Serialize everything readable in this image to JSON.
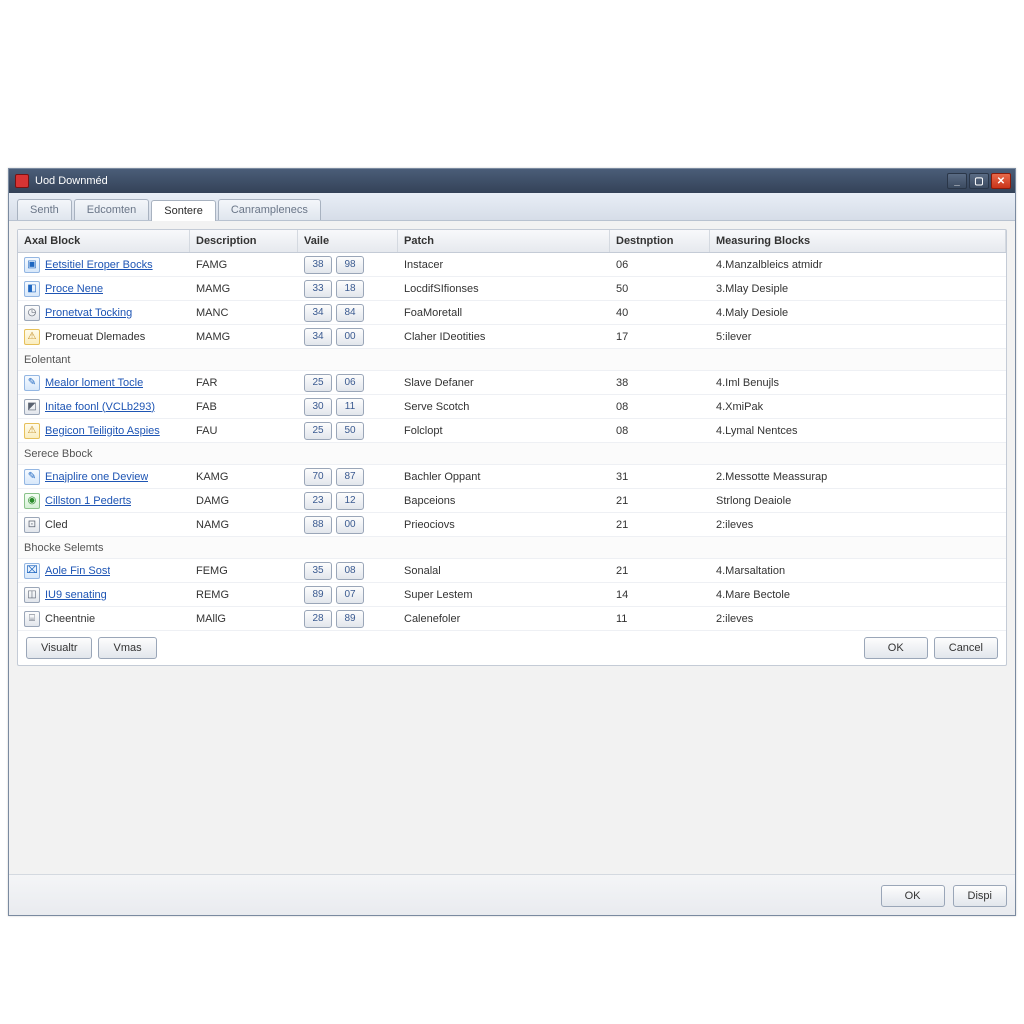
{
  "window": {
    "title": "Uod Downméd",
    "buttons": {
      "min": "_",
      "max": "▢",
      "close": "✕"
    }
  },
  "tabs": [
    {
      "label": "Senth"
    },
    {
      "label": "Edcomten"
    },
    {
      "label": "Sontere",
      "active": true
    },
    {
      "label": "Canramplenecs"
    }
  ],
  "columns": {
    "block": "Axal Block",
    "descr": "Description",
    "value": "Vaile",
    "patch": "Patch",
    "destn": "Destnption",
    "meas": "Measuring Blocks"
  },
  "groups": [
    {
      "label": "",
      "rows": [
        {
          "icon": "ic-blue",
          "glyph": "▣",
          "name": "Eetsitiel Eroper Bocks",
          "link": true,
          "descr": "FAMG",
          "v1": "38",
          "v2": "98",
          "patch": "Instacer",
          "destn": "06",
          "meas": "4.Manzalbleics atmidr"
        },
        {
          "icon": "ic-blue",
          "glyph": "◧",
          "name": "Proce Nene",
          "link": true,
          "descr": "MAMG",
          "v1": "33",
          "v2": "18",
          "patch": "LocdifSIfionses",
          "destn": "50",
          "meas": "3.Mlay Desiple"
        },
        {
          "icon": "ic-gray",
          "glyph": "◷",
          "name": "Pronetvat Tocking",
          "link": true,
          "descr": "MANC",
          "v1": "34",
          "v2": "84",
          "patch": "FoaMoretall",
          "destn": "40",
          "meas": "4.Maly Desiole"
        },
        {
          "icon": "ic-warn",
          "glyph": "⚠",
          "name": "Promeuat Dlemades",
          "link": false,
          "descr": "MAMG",
          "v1": "34",
          "v2": "00",
          "patch": "Claher IDeotities",
          "destn": "17",
          "meas": "5:ilever"
        }
      ]
    },
    {
      "label": "Eolentant",
      "rows": [
        {
          "icon": "ic-blue",
          "glyph": "✎",
          "name": "Mealor loment Tocle",
          "link": true,
          "descr": "FAR",
          "v1": "25",
          "v2": "06",
          "patch": "Slave Defaner",
          "destn": "38",
          "meas": "4.Iml Benujls"
        },
        {
          "icon": "ic-gray",
          "glyph": "◩",
          "name": "Initae foonl (VCLb293)",
          "link": true,
          "descr": "FAB",
          "v1": "30",
          "v2": "11",
          "patch": "Serve Scotch",
          "destn": "08",
          "meas": "4.XmiPak"
        },
        {
          "icon": "ic-warn",
          "glyph": "⚠",
          "name": "Begicon Teiligito Aspies",
          "link": true,
          "descr": "FAU",
          "v1": "25",
          "v2": "50",
          "patch": "Folclopt",
          "destn": "08",
          "meas": "4.Lymal Nentces"
        }
      ]
    },
    {
      "label": "Serece Bbock",
      "rows": [
        {
          "icon": "ic-blue",
          "glyph": "✎",
          "name": "Enajplire one Deview",
          "link": true,
          "descr": "KAMG",
          "v1": "70",
          "v2": "87",
          "patch": "Bachler Oppant",
          "destn": "31",
          "meas": "2.Messotte Meassurap"
        },
        {
          "icon": "ic-green",
          "glyph": "◉",
          "name": "Cillston 1 Pederts",
          "link": true,
          "descr": "DAMG",
          "v1": "23",
          "v2": "12",
          "patch": "Bapceions",
          "destn": "21",
          "meas": "Strlong Deaiole"
        },
        {
          "icon": "ic-gray",
          "glyph": "⊡",
          "name": "Cled",
          "link": false,
          "descr": "NAMG",
          "v1": "88",
          "v2": "00",
          "patch": "Prieociovs",
          "destn": "21",
          "meas": "2:ileves"
        }
      ]
    },
    {
      "label": "Bhocke Selemts",
      "rows": [
        {
          "icon": "ic-blue",
          "glyph": "⌧",
          "name": "Aole Fin Sost",
          "link": true,
          "descr": "FEMG",
          "v1": "35",
          "v2": "08",
          "patch": "Sonalal",
          "destn": "21",
          "meas": "4.Marsaltation"
        },
        {
          "icon": "ic-gray",
          "glyph": "◫",
          "name": "IU9 senating",
          "link": true,
          "descr": "REMG",
          "v1": "89",
          "v2": "07",
          "patch": "Super Lestem",
          "destn": "14",
          "meas": "4.Mare Bectole"
        },
        {
          "icon": "ic-gray",
          "glyph": "⌸",
          "name": "Cheentnie",
          "link": false,
          "descr": "MAllG",
          "v1": "28",
          "v2": "89",
          "patch": "Calenefoler",
          "destn": "11",
          "meas": "2:ileves"
        }
      ]
    }
  ],
  "panel_footer": {
    "visualtr": "Visualtr",
    "vmas": "Vmas",
    "ok": "OK",
    "cancel": "Cancel"
  },
  "outer_footer": {
    "ok": "OK",
    "dispi": "Dispi"
  }
}
